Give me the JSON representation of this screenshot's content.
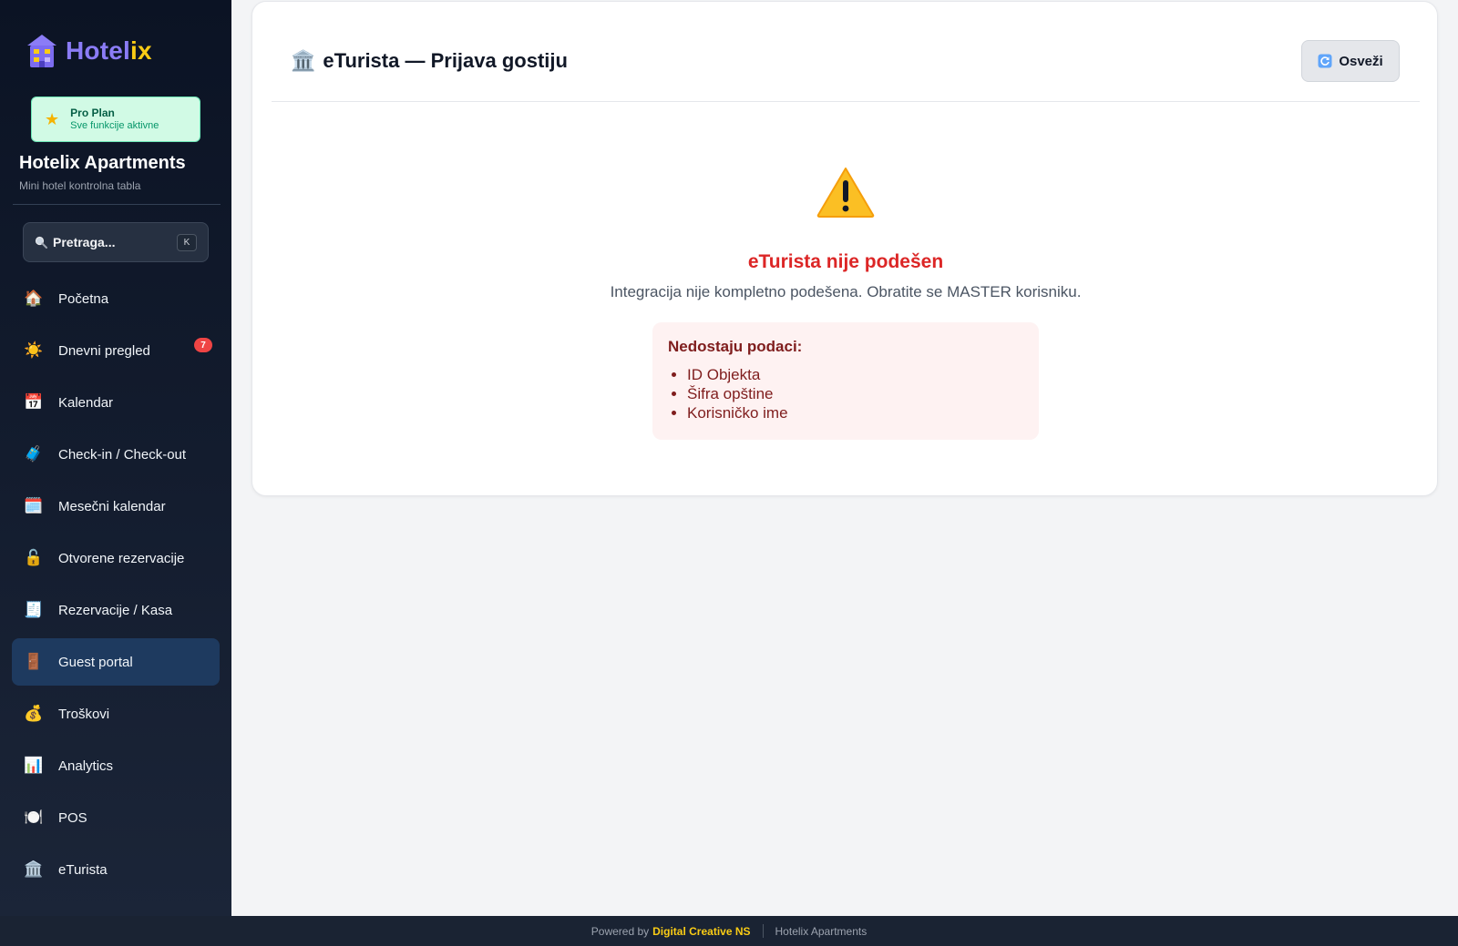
{
  "brand": {
    "part1": "Hotel",
    "part2": "ix"
  },
  "plan": {
    "icon": "star-icon",
    "title": "Pro Plan",
    "subtitle": "Sve funkcije aktivne"
  },
  "hotel": {
    "name": "Hotelix Apartments",
    "subtitle": "Mini hotel kontrolna tabla"
  },
  "search": {
    "label": "Pretraga...",
    "shortcut": "K"
  },
  "nav": {
    "items": [
      {
        "icon": "🏠",
        "icon_name": "house-icon",
        "label": "Početna"
      },
      {
        "icon": "☀️",
        "icon_name": "sun-icon",
        "label": "Dnevni pregled",
        "badge": "7"
      },
      {
        "icon": "📅",
        "icon_name": "calendar-icon",
        "label": "Kalendar"
      },
      {
        "icon": "🧳",
        "icon_name": "luggage-icon",
        "label": "Check-in / Check-out"
      },
      {
        "icon": "🗓️",
        "icon_name": "spiral-calendar-icon",
        "label": "Mesečni kalendar"
      },
      {
        "icon": "🔓",
        "icon_name": "unlock-icon",
        "label": "Otvorene rezervacije"
      },
      {
        "icon": "🧾",
        "icon_name": "receipt-icon",
        "label": "Rezervacije / Kasa"
      },
      {
        "icon": "🚪",
        "icon_name": "door-icon",
        "label": "Guest portal",
        "active": true
      },
      {
        "icon": "💰",
        "icon_name": "money-bag-icon",
        "label": "Troškovi"
      },
      {
        "icon": "📊",
        "icon_name": "bar-chart-icon",
        "label": "Analytics"
      },
      {
        "icon": "🍽️",
        "icon_name": "plate-icon",
        "label": "POS"
      },
      {
        "icon": "🏛️",
        "icon_name": "classical-building-icon",
        "label": "eTurista"
      }
    ]
  },
  "main": {
    "title_icon": "🏛️",
    "title_icon_name": "classical-building-icon",
    "title": "eTurista — Prijava gostiju",
    "refresh_label": "Osveži",
    "refresh_icon": "refresh-icon",
    "warning_icon": "warning-icon",
    "error_title": "eTurista nije podešen",
    "error_description": "Integracija nije kompletno podešena. Obratite se MASTER korisniku.",
    "missing": {
      "title": "Nedostaju podaci:",
      "items": [
        "ID Objekta",
        "Šifra opštine",
        "Korisničko ime"
      ]
    }
  },
  "footer": {
    "powered_by": "Powered by",
    "company": "Digital Creative NS",
    "app": "Hotelix Apartments"
  },
  "colors": {
    "sidebar_bg": "#0b1324",
    "accent_purple": "#8b7cf6",
    "accent_yellow": "#facc15",
    "error_red": "#dc2626",
    "plan_green": "#d1fae5",
    "badge_red": "#ef4444"
  }
}
